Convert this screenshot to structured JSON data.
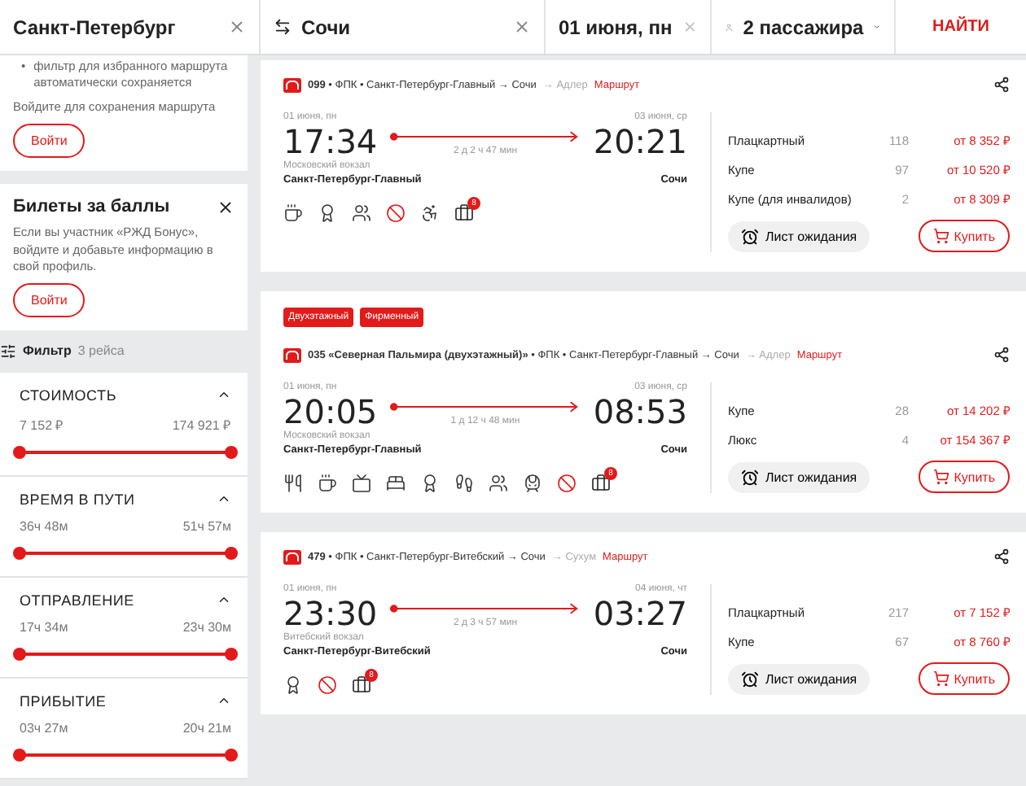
{
  "search_bar": {
    "from": "Санкт-Петербург",
    "to": "Сочи",
    "date": "01 июня, пн",
    "passengers": "2 пассажира",
    "submit": "НАЙТИ"
  },
  "sidebar": {
    "login_card": {
      "bullet_mark": "•",
      "bullet": "фильтр для избранного маршрута автоматически сохраняется",
      "text": "Войдите для сохранения маршрута",
      "button": "Войти"
    },
    "bonus_card": {
      "title": "Билеты за баллы",
      "text": "Если вы участник «РЖД Бонус», войдите и добавьте информацию в свой профиль.",
      "button": "Войти"
    },
    "filter": {
      "label": "Фильтр",
      "count": "3 рейса"
    },
    "sections": [
      {
        "title": "СТОИМОСТЬ",
        "expanded": true,
        "min": "7 152 ₽",
        "max": "174 921 ₽",
        "level": 1
      },
      {
        "title": "ВРЕМЯ В ПУТИ",
        "expanded": true,
        "min": "36ч 48м",
        "max": "51ч 57м",
        "level": 1
      },
      {
        "title": "ОТПРАВЛЕНИЕ",
        "expanded": true,
        "min": "17ч 34м",
        "max": "23ч 30м",
        "level": 1
      },
      {
        "title": "ПРИБЫТИЕ",
        "expanded": true,
        "min": "03ч 27м",
        "max": "20ч 21м",
        "level": 1
      }
    ]
  },
  "trains": [
    {
      "info": "**099** • ФПК • Санкт-Петербург-Главный → Сочи",
      "extension": "→ Адлер",
      "route_link": "Маршрут",
      "dep_date": "01 июня, пн",
      "dep_time": "17:34",
      "dep_station_note": "Московский вокзал",
      "dep_station": "Санкт-Петербург-Главный",
      "duration": "2 д 2 ч 47 мин",
      "arr_date": "03 июня, ср",
      "arr_time": "20:21",
      "arr_station": "Сочи",
      "amenities": [
        {
          "kind": "coffee"
        },
        {
          "kind": "award"
        },
        {
          "kind": "people"
        },
        {
          "kind": "no-pets"
        },
        {
          "kind": "wheelchair"
        },
        {
          "kind": "baggage",
          "badge": "8"
        }
      ],
      "classes": [
        {
          "name": "Плацкартный",
          "seats": "118",
          "price": "от 8 352 ₽"
        },
        {
          "name": "Купе",
          "seats": "97",
          "price": "от 10 520 ₽"
        },
        {
          "name": "Купе (для инвалидов)",
          "seats": "2",
          "price": "от 8 309 ₽"
        }
      ],
      "wait_button": "Лист ожидания",
      "buy_button": "Купить"
    },
    {
      "tags": [
        "Двухэтажный",
        "Фирменный"
      ],
      "info": "**035 «Северная Пальмира (двухэтажный)»** • ФПК • Санкт-Петербург-Главный → Сочи",
      "extension": "→ Адлер",
      "route_link": "Маршрут",
      "dep_date": "01 июня, пн",
      "dep_time": "20:05",
      "dep_station_note": "Московский вокзал",
      "dep_station": "Санкт-Петербург-Главный",
      "duration": "1 д 12 ч 48 мин",
      "arr_date": "03 июня, ср",
      "arr_time": "08:53",
      "arr_station": "Сочи",
      "amenities": [
        {
          "kind": "food"
        },
        {
          "kind": "coffee"
        },
        {
          "kind": "tv"
        },
        {
          "kind": "bed"
        },
        {
          "kind": "award"
        },
        {
          "kind": "stairs"
        },
        {
          "kind": "people"
        },
        {
          "kind": "train"
        },
        {
          "kind": "no-pets"
        },
        {
          "kind": "baggage",
          "badge": "8"
        }
      ],
      "classes": [
        {
          "name": "Купе",
          "seats": "28",
          "price": "от 14 202 ₽"
        },
        {
          "name": "Люкс",
          "seats": "4",
          "price": "от 154 367 ₽"
        }
      ],
      "wait_button": "Лист ожидания",
      "buy_button": "Купить"
    },
    {
      "info": "**479** • ФПК • Санкт-Петербург-Витебский → Сочи",
      "extension": "→ Сухум",
      "route_link": "Маршрут",
      "dep_date": "01 июня, пн",
      "dep_time": "23:30",
      "dep_station_note": "Витебский вокзал",
      "dep_station": "Санкт-Петербург-Витебский",
      "duration": "2 д 3 ч 57 мин",
      "arr_date": "04 июня, чт",
      "arr_time": "03:27",
      "arr_station": "Сочи",
      "amenities": [
        {
          "kind": "award"
        },
        {
          "kind": "no-pets"
        },
        {
          "kind": "baggage",
          "badge": "8"
        }
      ],
      "classes": [
        {
          "name": "Плацкартный",
          "seats": "217",
          "price": "от 7 152 ₽"
        },
        {
          "name": "Купе",
          "seats": "67",
          "price": "от 8 760 ₽"
        }
      ],
      "wait_button": "Лист ожидания",
      "buy_button": "Купить"
    }
  ]
}
